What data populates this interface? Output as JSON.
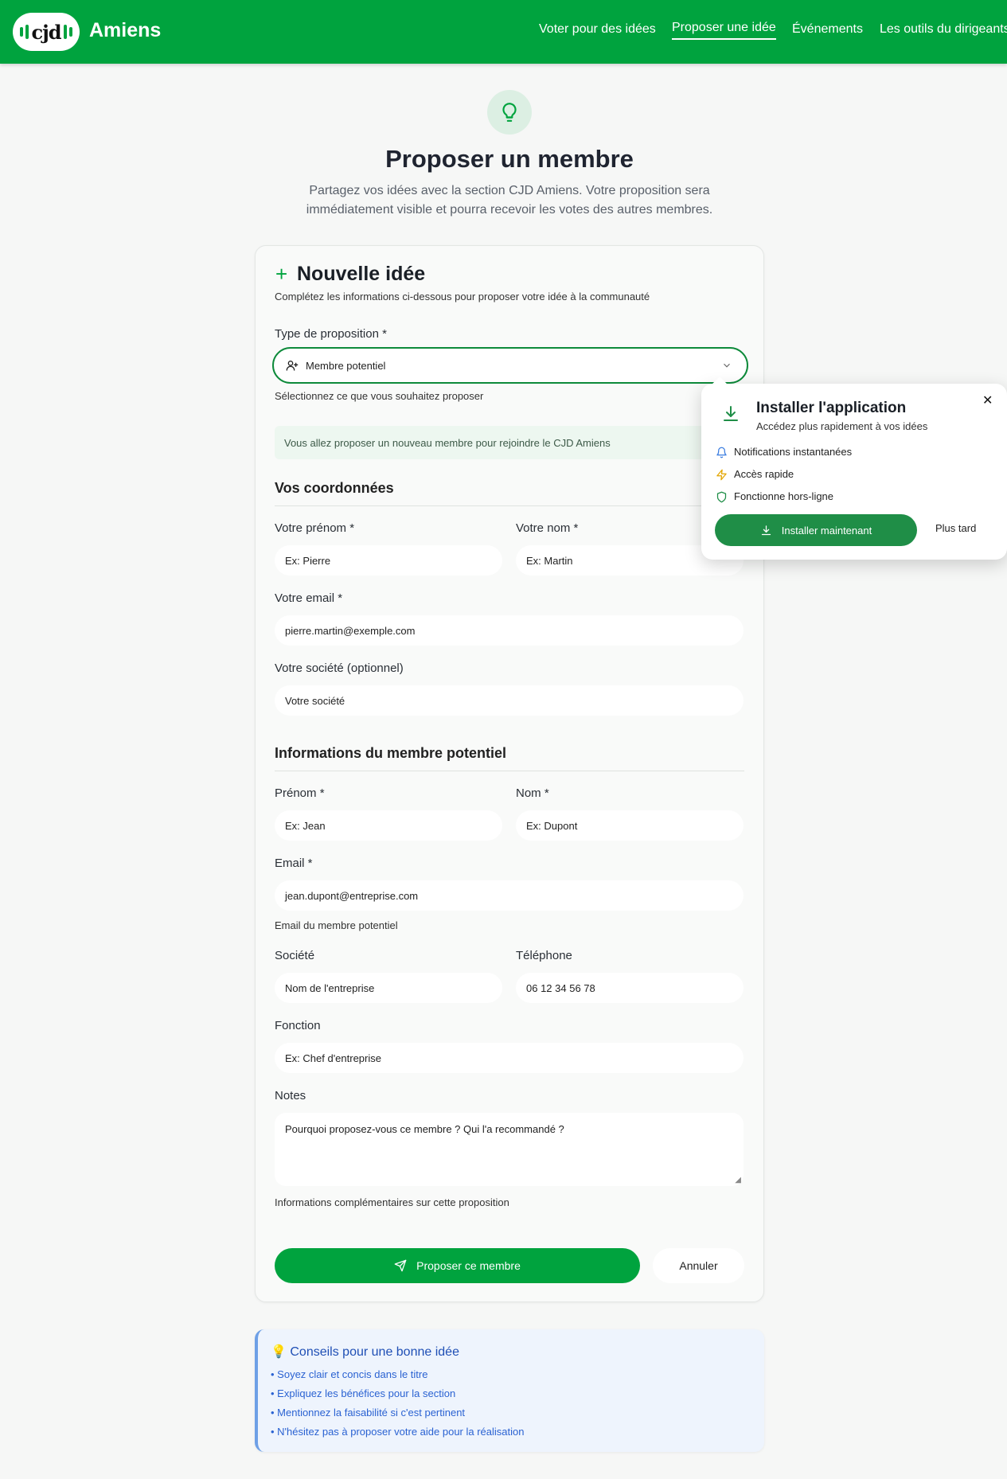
{
  "header": {
    "brand": "Amiens",
    "logo_text": "cjd",
    "nav": [
      {
        "label": "Voter pour des idées"
      },
      {
        "label": "Proposer une idée"
      },
      {
        "label": "Événements"
      },
      {
        "label": "Les outils du dirigeants"
      }
    ],
    "active_nav": "Proposer une idée"
  },
  "hero": {
    "icon": "lightbulb-icon",
    "title": "Proposer un membre",
    "subtitle": "Partagez vos idées avec la section CJD Amiens. Votre proposition sera immédiatement visible et pourra recevoir les votes des autres membres."
  },
  "form": {
    "title": "Nouvelle idée",
    "subtitle": "Complétez les informations ci-dessous pour proposer votre idée à la communauté",
    "type_label": "Type de proposition *",
    "type_value": "Membre potentiel",
    "type_hint": "Sélectionnez ce que vous souhaitez proposer",
    "info": "Vous allez proposer un nouveau membre pour rejoindre le CJD Amiens",
    "section_you": "Vos coordonnées",
    "firstname_label": "Votre prénom *",
    "firstname_placeholder": "Ex: Pierre",
    "lastname_label": "Votre nom *",
    "lastname_placeholder": "Ex: Martin",
    "email_label": "Votre email *",
    "email_placeholder": "pierre.martin@exemple.com",
    "company_label": "Votre société (optionnel)",
    "company_placeholder": "Votre société",
    "section_member": "Informations du membre potentiel",
    "m_firstname_label": "Prénom *",
    "m_firstname_placeholder": "Ex: Jean",
    "m_lastname_label": "Nom *",
    "m_lastname_placeholder": "Ex: Dupont",
    "m_email_label": "Email *",
    "m_email_placeholder": "jean.dupont@entreprise.com",
    "m_email_hint": "Email du membre potentiel",
    "m_company_label": "Société",
    "m_company_placeholder": "Nom de l'entreprise",
    "m_phone_label": "Téléphone",
    "m_phone_placeholder": "06 12 34 56 78",
    "m_role_label": "Fonction",
    "m_role_placeholder": "Ex: Chef d'entreprise",
    "notes_label": "Notes",
    "notes_placeholder": "Pourquoi proposez-vous ce membre ? Qui l'a recommandé ?",
    "notes_hint": "Informations complémentaires sur cette proposition",
    "submit": "Proposer ce membre",
    "cancel": "Annuler"
  },
  "tips": {
    "title": "💡 Conseils pour une bonne idée",
    "items": [
      "• Soyez clair et concis dans le titre",
      "• Expliquez les bénéfices pour la section",
      "• Mentionnez la faisabilité si c'est pertinent",
      "• N'hésitez pas à proposer votre aide pour la réalisation"
    ]
  },
  "install_popup": {
    "title": "Installer l'application",
    "subtitle": "Accédez plus rapidement à vos idées",
    "features": [
      "Notifications instantanées",
      "Accès rapide",
      "Fonctionne hors-ligne"
    ],
    "install_button": "Installer maintenant",
    "later_button": "Plus tard"
  },
  "colors": {
    "brand_green": "#00a33e",
    "install_green": "#1f8e47",
    "tips_blue": "#2a62d2"
  }
}
